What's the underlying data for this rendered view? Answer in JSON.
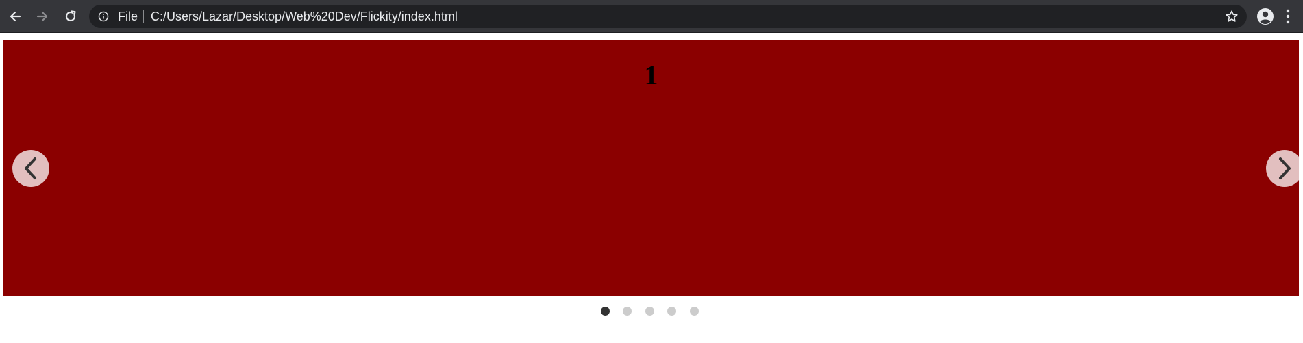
{
  "browser": {
    "back_icon": "arrow-left-icon",
    "forward_icon": "arrow-right-icon",
    "reload_icon": "reload-icon",
    "site_info_icon": "info-icon",
    "scheme_label": "File",
    "url": "C:/Users/Lazar/Desktop/Web%20Dev/Flickity/index.html",
    "bookmark_icon": "star-icon",
    "profile_icon": "account-circle-icon",
    "menu_icon": "vertical-dots-icon",
    "toolbar_color": "#35363a",
    "omnibox_color": "#202124"
  },
  "carousel": {
    "slide_number": "1",
    "slide_color": "#8b0000",
    "prev_icon": "chevron-left-icon",
    "next_icon": "chevron-right-icon",
    "slide_count": 5,
    "selected_index": 0,
    "dot_active_color": "#333333",
    "dot_inactive_color": "#cccccc"
  }
}
